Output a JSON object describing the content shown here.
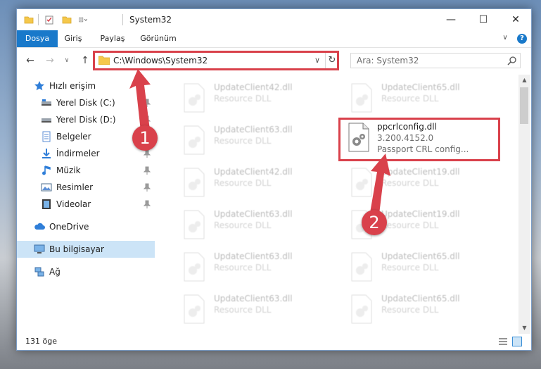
{
  "window": {
    "title": "System32",
    "minimize": "—",
    "maximize": "☐",
    "close": "✕"
  },
  "ribbon": {
    "tabs": [
      "Dosya",
      "Giriş",
      "Paylaş",
      "Görünüm"
    ],
    "expand": "∨",
    "help": "?"
  },
  "nav": {
    "back": "←",
    "forward": "→",
    "recent": "∨",
    "up": "↑",
    "address": "C:\\Windows\\System32",
    "address_dropdown": "∨",
    "refresh": "↻",
    "search_placeholder": "Ara: System32"
  },
  "sidebar": {
    "items": [
      {
        "label": "Hızlı erişim",
        "icon": "star-icon"
      },
      {
        "label": "Yerel Disk (C:)",
        "icon": "drive-icon",
        "pinned": true
      },
      {
        "label": "Yerel Disk (D:)",
        "icon": "drive-icon",
        "pinned": true
      },
      {
        "label": "Belgeler",
        "icon": "documents-icon",
        "pinned": true
      },
      {
        "label": "İndirmeler",
        "icon": "download-icon",
        "pinned": true
      },
      {
        "label": "Müzik",
        "icon": "music-icon",
        "pinned": true
      },
      {
        "label": "Resimler",
        "icon": "pictures-icon",
        "pinned": true
      },
      {
        "label": "Videolar",
        "icon": "video-icon",
        "pinned": true
      },
      {
        "label": "OneDrive",
        "icon": "cloud-icon"
      },
      {
        "label": "Bu bilgisayar",
        "icon": "computer-icon",
        "selected": true
      },
      {
        "label": "Ağ",
        "icon": "network-icon"
      }
    ]
  },
  "files": [
    {
      "name": "UpdateClient42.dll",
      "type": "Resource DLL"
    },
    {
      "name": "UpdateClient65.dll",
      "type": "Resource DLL"
    },
    {
      "name": "UpdateClient63.dll",
      "type": "Resource DLL"
    },
    {
      "name": "ppcrlconfig.dll",
      "version": "3.200.4152.0",
      "type": "Passport CRL config...",
      "highlighted": true
    },
    {
      "name": "UpdateClient42.dll",
      "type": "Resource DLL"
    },
    {
      "name": "UpdateClient19.dll",
      "type": "Resource DLL"
    },
    {
      "name": "UpdateClient63.dll",
      "type": "Resource DLL"
    },
    {
      "name": "UpdateClient19.dll",
      "type": "Resource DLL"
    },
    {
      "name": "UpdateClient63.dll",
      "type": "Resource DLL"
    },
    {
      "name": "UpdateClient65.dll",
      "type": "Resource DLL"
    },
    {
      "name": "UpdateClient63.dll",
      "type": "Resource DLL"
    },
    {
      "name": "UpdateClient65.dll",
      "type": "Resource DLL"
    }
  ],
  "status": {
    "item_count": "131 öge"
  },
  "callouts": [
    "1",
    "2"
  ],
  "colors": {
    "accent": "#1979ca",
    "highlight": "#d9414b",
    "selected_bg": "#cce4f7"
  }
}
